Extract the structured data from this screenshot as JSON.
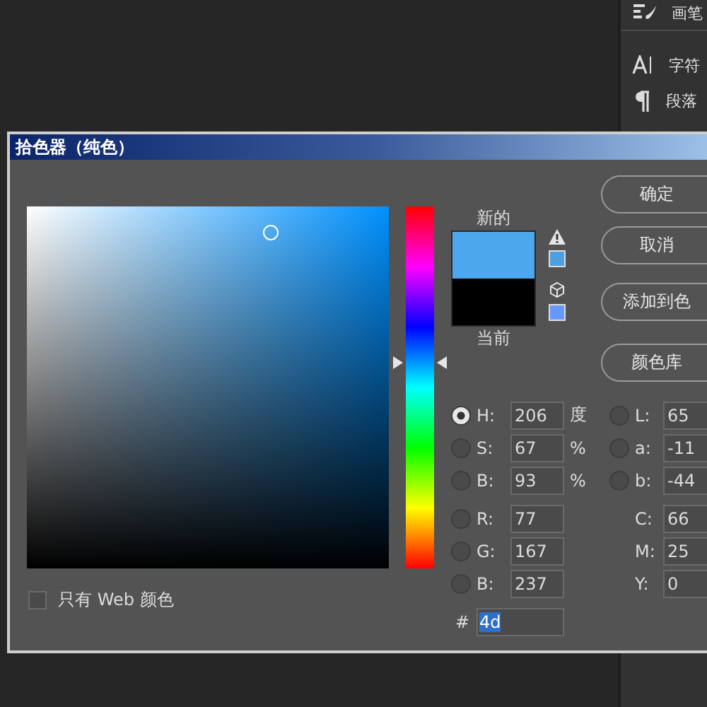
{
  "side_panel": {
    "items": [
      {
        "kind": "brush",
        "label": "画笔"
      },
      {
        "kind": "character",
        "label": "字符"
      },
      {
        "kind": "paragraph",
        "label": "段落"
      }
    ]
  },
  "dialog": {
    "title": "拾色器（纯色）",
    "new_label": "新的",
    "current_label": "当前",
    "hue_slider": {
      "level": 0.572
    },
    "buttons": [
      "确定",
      "取消",
      "添加到色",
      "颜色库"
    ],
    "hsb": [
      {
        "label": "H:",
        "value": "206",
        "unit": "度",
        "selected": true
      },
      {
        "label": "S:",
        "value": "67",
        "unit": "%",
        "selected": false
      },
      {
        "label": "B:",
        "value": "93",
        "unit": "%",
        "selected": false
      }
    ],
    "lab": [
      {
        "label": "L:",
        "value": "65",
        "selected": false
      },
      {
        "label": "a:",
        "value": "-11",
        "selected": false
      },
      {
        "label": "b:",
        "value": "-44",
        "selected": false
      }
    ],
    "rgb": [
      {
        "label": "R:",
        "value": "77",
        "selected": false
      },
      {
        "label": "G:",
        "value": "167",
        "selected": false
      },
      {
        "label": "B:",
        "value": "237",
        "selected": false
      }
    ],
    "cmyk": [
      {
        "label": "C:",
        "value": "66"
      },
      {
        "label": "M:",
        "value": "25"
      },
      {
        "label": "Y:",
        "value": "0"
      }
    ],
    "hex": {
      "label": "#",
      "value": "4d"
    },
    "web_only": {
      "label": "只有 Web 颜色",
      "checked": false
    }
  }
}
